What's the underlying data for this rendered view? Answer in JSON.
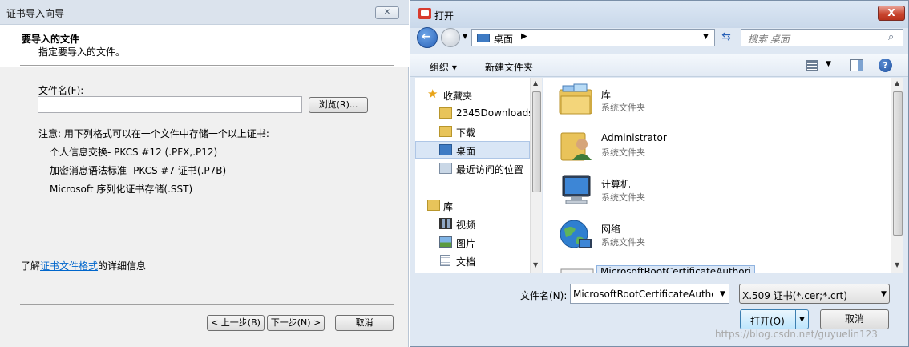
{
  "wizard": {
    "title": "证书导入向导",
    "close_glyph": "✕",
    "header_title": "要导入的文件",
    "header_subtitle": "指定要导入的文件。",
    "filename_label": "文件名(F):",
    "filename_value": "",
    "browse_label": "浏览(R)...",
    "note": "注意: 用下列格式可以在一个文件中存储一个以上证书:",
    "formats": [
      "个人信息交换- PKCS #12 (.PFX,.P12)",
      "加密消息语法标准- PKCS #7 证书(.P7B)",
      "Microsoft 序列化证书存储(.SST)"
    ],
    "more_info_prefix": "了解",
    "more_info_link": "证书文件格式",
    "more_info_suffix": "的详细信息",
    "back_label": "< 上一步(B)",
    "next_label": "下一步(N) >",
    "cancel_label": "取消"
  },
  "open_dialog": {
    "title": "打开",
    "close_glyph": "X",
    "address": "桌面",
    "address_arrow": "▶",
    "dropdown_glyph": "▼",
    "refresh_glyph": "⇆",
    "search_placeholder": "搜索 桌面",
    "toolbar": {
      "organize": "组织 ▾",
      "new_folder": "新建文件夹",
      "help_glyph": "?"
    },
    "nav": {
      "favorites": "收藏夹",
      "favorites_items": [
        "2345Downloads",
        "下载",
        "桌面",
        "最近访问的位置"
      ],
      "libraries": "库",
      "libraries_items": [
        "视频",
        "图片",
        "文档"
      ]
    },
    "files": [
      {
        "name": "库",
        "type": "系统文件夹"
      },
      {
        "name": "Administrator",
        "type": "系统文件夹"
      },
      {
        "name": "计算机",
        "type": "系统文件夹"
      },
      {
        "name": "网络",
        "type": "系统文件夹"
      },
      {
        "name": "MicrosoftRootCertificateAuthori",
        "type": ""
      }
    ],
    "filename_label": "文件名(N):",
    "filename_value": "MicrosoftRootCertificateAutho",
    "filter_value": "X.509 证书(*.cer;*.crt)",
    "open_label": "打开(O)",
    "cancel_label": "取消",
    "watermark": "https://blog.csdn.net/guyuelin123"
  },
  "colors": {
    "wizard_bg": "#f0f0f0",
    "dialog_bg": "#dfe8f3",
    "link": "#0066cc",
    "selection": "#d9e6f6",
    "close_red": "#c9462f"
  }
}
